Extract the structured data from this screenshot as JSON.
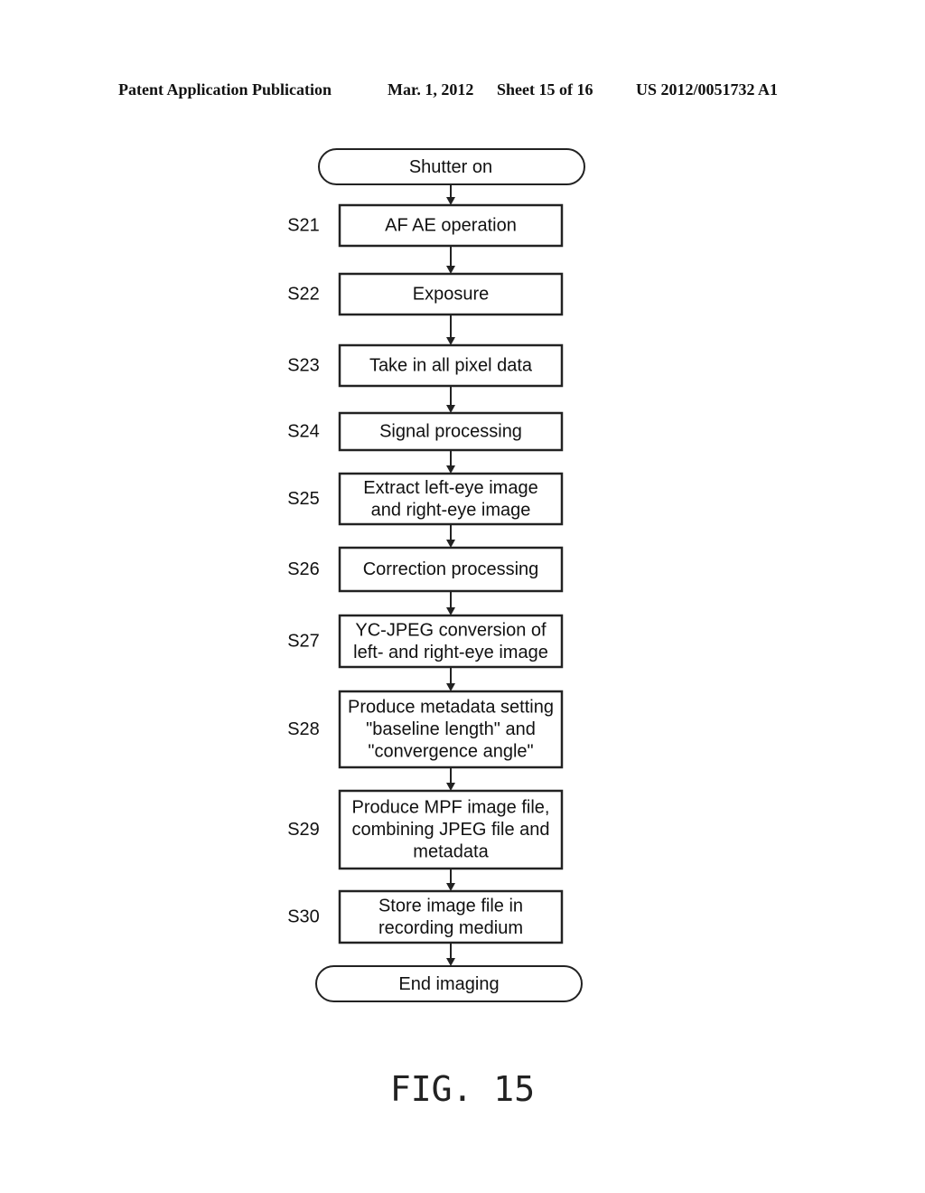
{
  "header": {
    "left": "Patent Application Publication",
    "date": "Mar. 1, 2012",
    "sheet": "Sheet 15 of 16",
    "number": "US 2012/0051732 A1"
  },
  "flowchart": {
    "start": "Shutter on",
    "steps": [
      {
        "id": "S21",
        "lines": [
          "AF AE operation"
        ]
      },
      {
        "id": "S22",
        "lines": [
          "Exposure"
        ]
      },
      {
        "id": "S23",
        "lines": [
          "Take in all pixel data"
        ]
      },
      {
        "id": "S24",
        "lines": [
          "Signal processing"
        ]
      },
      {
        "id": "S25",
        "lines": [
          "Extract left-eye image",
          "and right-eye image"
        ]
      },
      {
        "id": "S26",
        "lines": [
          "Correction processing"
        ]
      },
      {
        "id": "S27",
        "lines": [
          "YC-JPEG conversion of",
          "left- and right-eye image"
        ]
      },
      {
        "id": "S28",
        "lines": [
          "Produce metadata setting",
          "\"baseline length\" and",
          "\"convergence angle\""
        ]
      },
      {
        "id": "S29",
        "lines": [
          "Produce MPF image file,",
          "combining JPEG file and",
          "metadata"
        ]
      },
      {
        "id": "S30",
        "lines": [
          "Store image file in",
          "recording medium"
        ]
      }
    ],
    "end": "End imaging"
  },
  "figure_label": "FIG. 15"
}
